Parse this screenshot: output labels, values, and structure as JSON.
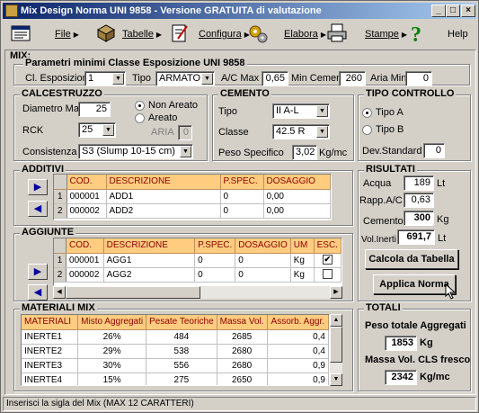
{
  "window": {
    "title": "Mix Design Norma UNI 9858 - Versione GRATUITA di valutazione"
  },
  "toolbar": {
    "items": [
      {
        "label": "File",
        "icon": "file-icon"
      },
      {
        "label": "Tabelle",
        "icon": "tables-icon"
      },
      {
        "label": "Configura",
        "icon": "configure-icon"
      },
      {
        "label": "Elabora",
        "icon": "process-icon"
      },
      {
        "label": "Stampe",
        "icon": "printer-icon"
      },
      {
        "label": "Help",
        "icon": "help-icon"
      }
    ]
  },
  "mix": {
    "label": "MIX:",
    "params_title": "Parametri minimi Classe Esposizione UNI 9858",
    "cl_esposizione_label": "Cl. Esposizione",
    "cl_esposizione_value": "1",
    "tipo_label": "Tipo",
    "tipo_value": "ARMATO",
    "ac_max_label": "A/C Max",
    "ac_max_value": "0,65",
    "min_cemento_label": "Min Cemento",
    "min_cemento_value": "260",
    "aria_min_label": "Aria Min",
    "aria_min_value": "0"
  },
  "calcestruzzo": {
    "title": "CALCESTRUZZO",
    "diametro_label": "Diametro Max",
    "diametro_value": "25",
    "rck_label": "RCK",
    "rck_value": "25",
    "consistenza_label": "Consistenza",
    "consistenza_value": "S3 (Slump 10-15 cm)",
    "non_areato_label": "Non Areato",
    "areato_label": "Areato",
    "aria_label": "ARIA",
    "aria_value": "0"
  },
  "cemento": {
    "title": "CEMENTO",
    "tipo_label": "Tipo",
    "tipo_value": "II A-L",
    "classe_label": "Classe",
    "classe_value": "42.5 R",
    "peso_label": "Peso Specifico",
    "peso_value": "3,02",
    "peso_unit": "Kg/mc"
  },
  "tipo_controllo": {
    "title": "TIPO CONTROLLO",
    "tipo_a": "Tipo A",
    "tipo_b": "Tipo B",
    "dev_label": "Dev.Standard",
    "dev_value": "0"
  },
  "additivi": {
    "title": "ADDITIVI",
    "columns": [
      "COD.",
      "DESCRIZIONE",
      "P.SPEC.",
      "DOSAGGIO"
    ],
    "rows": [
      {
        "n": "1",
        "cod": "000001",
        "desc": "ADD1",
        "pspec": "0",
        "dos": "0,00"
      },
      {
        "n": "2",
        "cod": "000002",
        "desc": "ADD2",
        "pspec": "0",
        "dos": "0,00"
      }
    ]
  },
  "aggiunte": {
    "title": "AGGIUNTE",
    "columns": [
      "COD.",
      "DESCRIZIONE",
      "P.SPEC.",
      "DOSAGGIO",
      "UM",
      "ESC."
    ],
    "rows": [
      {
        "n": "1",
        "cod": "000001",
        "desc": "AGG1",
        "pspec": "0",
        "dos": "0",
        "um": "Kg",
        "esc": "✔"
      },
      {
        "n": "2",
        "cod": "000002",
        "desc": "AGG2",
        "pspec": "0",
        "dos": "0",
        "um": "Kg",
        "esc": ""
      }
    ]
  },
  "risultati": {
    "title": "RISULTATI",
    "acqua_label": "Acqua",
    "acqua_value": "189",
    "acqua_unit": "Lt",
    "rapp_label": "Rapp.A/C",
    "rapp_value": "0,63",
    "cemento_label": "Cemento",
    "cemento_value": "300",
    "cemento_unit": "Kg",
    "vol_label": "Vol.Inerti",
    "vol_value": "691,7",
    "vol_unit": "Lt",
    "calcola_btn": "Calcola da Tabella",
    "applica_btn": "Applica Norma"
  },
  "materiali": {
    "title": "MATERIALI MIX",
    "columns": [
      "MATERIALI",
      "Misto Aggregati",
      "Pesate Teoriche",
      "Massa Vol.",
      "Assorb. Aggr."
    ],
    "rows": [
      {
        "mat": "INERTE1",
        "misto": "26%",
        "pesate": "484",
        "massa": "2685",
        "assorb": "0,4"
      },
      {
        "mat": "INERTE2",
        "misto": "29%",
        "pesate": "538",
        "massa": "2680",
        "assorb": "0,4"
      },
      {
        "mat": "INERTE3",
        "misto": "30%",
        "pesate": "556",
        "massa": "2680",
        "assorb": "0,9"
      },
      {
        "mat": "INERTE4",
        "misto": "15%",
        "pesate": "275",
        "massa": "2650",
        "assorb": "0,9"
      }
    ]
  },
  "totali": {
    "title": "TOTALI",
    "peso_label": "Peso totale Aggregati",
    "peso_value": "1853",
    "peso_unit": "Kg",
    "massa_label": "Massa Vol. CLS fresco",
    "massa_value": "2342",
    "massa_unit": "Kg/mc"
  },
  "status": {
    "text": "Inserisci la sigla del Mix (MAX 12 CARATTERI)"
  }
}
